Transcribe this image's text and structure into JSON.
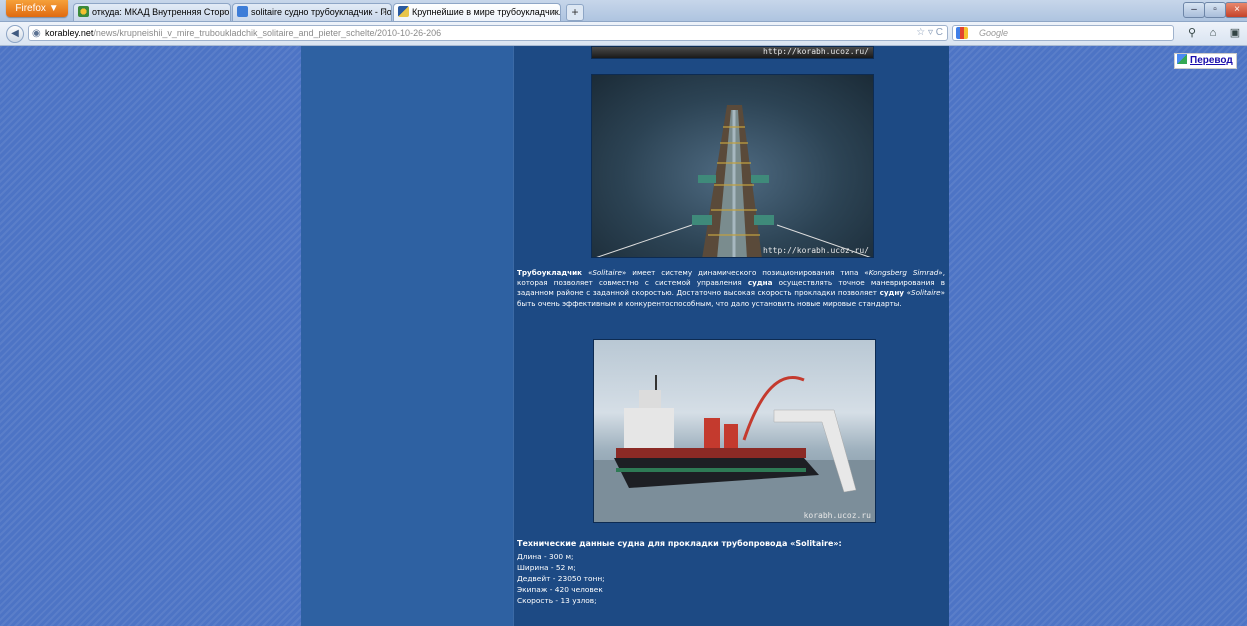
{
  "browser": {
    "menu_label": "Firefox ▼",
    "tabs": [
      {
        "label": "откуда: МКАД Внутренняя Сторона(...",
        "active": false
      },
      {
        "label": "solitaire судно трубоукладчик - Пои...",
        "active": false
      },
      {
        "label": "Крупнейшие в мире трубоукладчик...",
        "active": true
      }
    ],
    "new_tab": "+",
    "url_host": "korabley.net",
    "url_path": "/news/krupneishii_v_mire_truboukladchik_solitaire_and_pieter_schelte/2010-10-26-206",
    "search_placeholder": "Google"
  },
  "translate": {
    "label": "Перевод"
  },
  "watermarks": {
    "photo1": "http://korabh.ucoz.ru/",
    "photo2": "http://korabh.ucoz.ru/",
    "photo3": "korabh.ucoz.ru"
  },
  "article": {
    "d1": "Трубоукладчик",
    "d2": " «",
    "d3": "Solitaire",
    "d4": "» имеет систему динамического позиционирования типа «",
    "d5": "Kongsberg Simrad",
    "d6": "», которая позволяет совместно с системой управления ",
    "d7": "судна",
    "d8": " осуществлять точное маневрирования в заданном районе с заданной скоростью. Достаточно высокая скорость прокладки позволяет ",
    "d9": "судну",
    "d10": " «",
    "d11": "Solitaire",
    "d12": "» быть очень эффективным и конкурентоспособным, что дало установить новые мировые стандарты.",
    "specs_title": "Технические данные судна для прокладки трубопровода «Solitaire»:",
    "specs": [
      "Длина - 300 м;",
      "Ширина - 52 м;",
      "Дедвейт - 23050 тонн;",
      "Экипаж - 420 человек",
      "Скорость - 13 узлов;"
    ]
  },
  "colors": {
    "page_bg": "#4d74c5",
    "content_bg": "#1d4a84",
    "side_bg": "#2e61a2",
    "firefox_button": "#e97a1e"
  }
}
